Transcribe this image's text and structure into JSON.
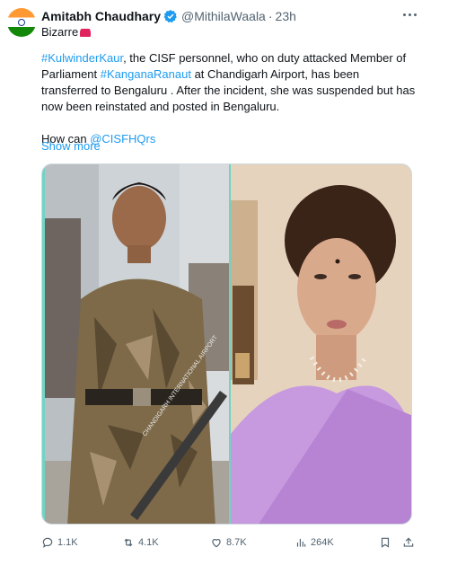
{
  "tweet": {
    "author_name": "Amitabh Chaudhary",
    "handle": "@MithilaWaala",
    "separator": "·",
    "time": "23h",
    "first_line": "Bizarre",
    "body": {
      "hashtag1": "#KulwinderKaur",
      "part1": ", the CISF personnel, who on duty attacked Member of Parliament ",
      "hashtag2": "#KanganaRanaut",
      "part2": " at Chandigarh Airport, has been transferred to Bengaluru . After the incident, she was suspended but has now been reinstated and posted in Bengaluru.",
      "question_prefix": "How can ",
      "mention": "@CISFHQrs"
    },
    "show_more": "Show more",
    "media_caption": "CHANDIGARH INTERNATIONAL AIRPORT"
  },
  "actions": {
    "replies": "1.1K",
    "reposts": "4.1K",
    "likes": "8.7K",
    "views": "264K"
  },
  "colors": {
    "link": "#1d9bf0",
    "secondary_text": "#536471",
    "verified": "#1d9bf0",
    "media_border_teal": "#6fd4c4"
  }
}
